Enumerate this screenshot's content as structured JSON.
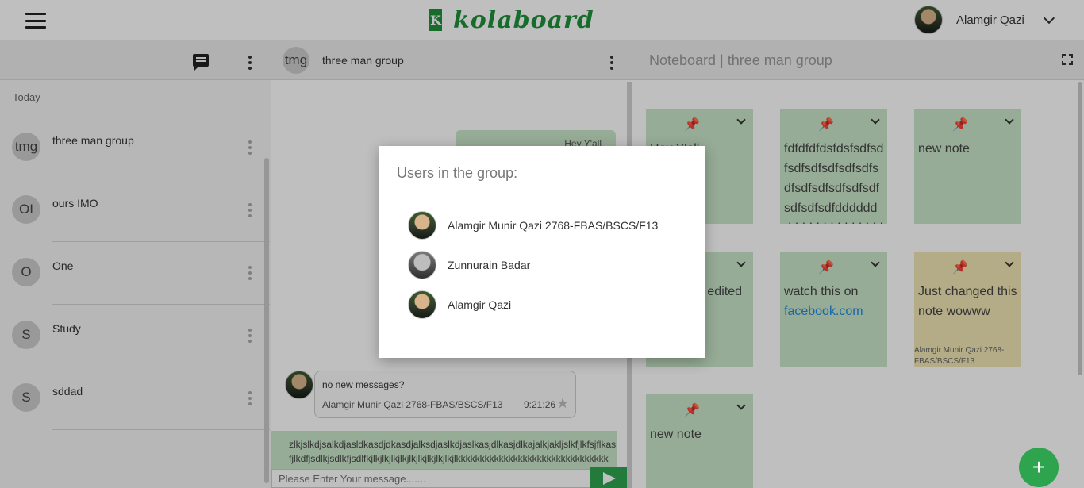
{
  "header": {
    "logo_mark": "K",
    "logo_text": "kolaboard",
    "user_name": "Alamgir Qazi"
  },
  "sidebar": {
    "day_label": "Today",
    "conversations": [
      {
        "initials": "tmg",
        "name": "three man group"
      },
      {
        "initials": "OI",
        "name": "ours IMO"
      },
      {
        "initials": "O",
        "name": "One"
      },
      {
        "initials": "S",
        "name": "Study"
      },
      {
        "initials": "S",
        "name": "sddad"
      }
    ]
  },
  "chat": {
    "initials": "tmg",
    "title": "three man group",
    "outgoing_top": "Hey Y'all",
    "incoming": {
      "text": "no new messages?",
      "author": "Alamgir Munir Qazi 2768-FBAS/BSCS/F13",
      "time": "9:21:26"
    },
    "outgoing_long": "zlkjslkdjsalkdjasldkasdjdkasdjalksdjaslkdjaslkasjdlkasjdlkajalkjakljslkfjlkfsjflkas fjlkdfjsdlkjsdlkfjsdlfkjlkjlkjlkjlkjlkjlkjlkjlkjlkjlkkkkkkkkkkkkkkkkkkkkkkkkkkkkkkkk",
    "input_placeholder": "Please Enter Your message......."
  },
  "noteboard": {
    "title": "Noteboard | three man group",
    "notes": [
      {
        "text": "Hey Y'all",
        "link": "",
        "author": ""
      },
      {
        "text": "fdfdfdfdsfdsfsdfsdfsdfsdfsdfsdfsdfsdfsdfsdfsdfsdfsdfsdfsdfsdfdddddddddddddddddddddd",
        "link": "",
        "author": ""
      },
      {
        "text": "new note",
        "link": "",
        "author": ""
      },
      {
        "text": "edited",
        "link": "",
        "author": ""
      },
      {
        "text": "watch this on ",
        "link": "facebook.com",
        "author": ""
      },
      {
        "text": "Just changed this note wowww",
        "link": "",
        "author": "Alamgir Munir Qazi 2768-FBAS/BSCS/F13"
      },
      {
        "text": "new note",
        "link": "",
        "author": ""
      }
    ],
    "fab_label": "+"
  },
  "modal": {
    "title": "Users in the group:",
    "members": [
      "Alamgir Munir Qazi 2768-FBAS/BSCS/F13",
      "Zunnurain Badar",
      "Alamgir Qazi"
    ]
  },
  "colors": {
    "brand_green": "#1f8f3a",
    "note_green": "#c8e6c9",
    "note_yellow": "#f0e6b4",
    "send_green": "#2ea44f"
  }
}
